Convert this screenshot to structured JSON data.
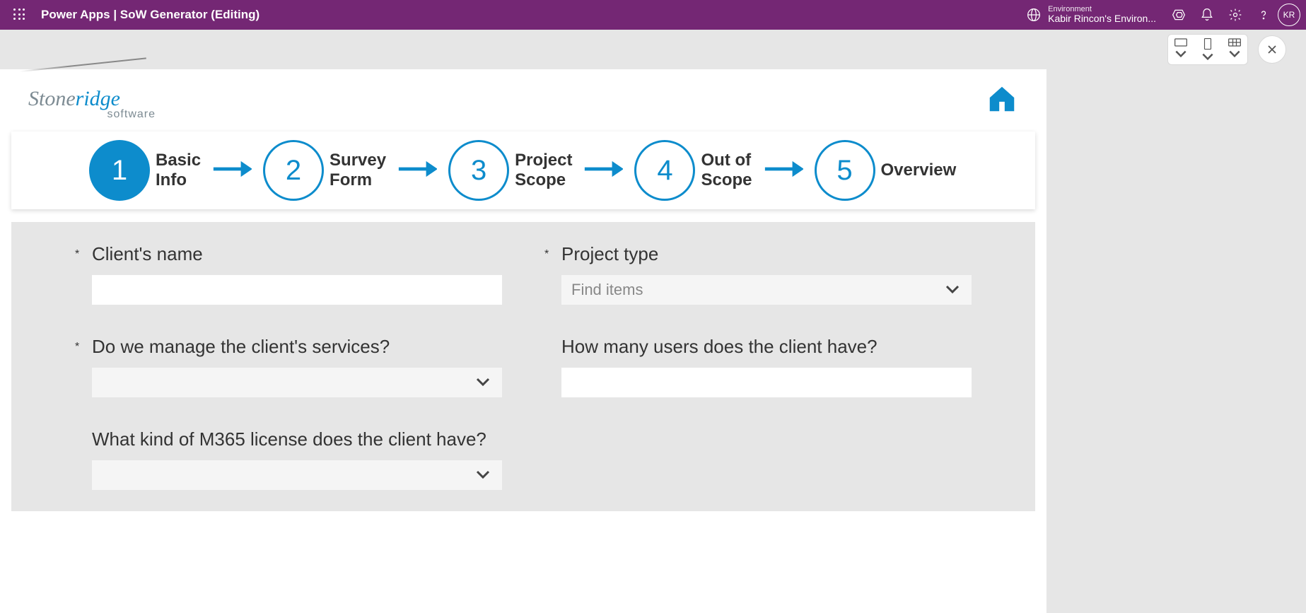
{
  "header": {
    "title": "Power Apps  |  SoW Generator (Editing)",
    "env_label": "Environment",
    "env_name": "Kabir Rincon's Environ...",
    "avatar_initials": "KR"
  },
  "logo": {
    "part1": "Stone",
    "part2": "ridge",
    "sub": "software"
  },
  "steps": [
    {
      "num": "1",
      "label": "Basic\nInfo",
      "active": true
    },
    {
      "num": "2",
      "label": "Survey\nForm",
      "active": false
    },
    {
      "num": "3",
      "label": "Project\nScope",
      "active": false
    },
    {
      "num": "4",
      "label": "Out of\nScope",
      "active": false
    },
    {
      "num": "5",
      "label": "Overview",
      "active": false
    }
  ],
  "form": {
    "client_name": {
      "label": "Client's name",
      "required": true,
      "value": ""
    },
    "project_type": {
      "label": "Project type",
      "required": true,
      "placeholder": "Find items",
      "value": ""
    },
    "manage_services": {
      "label": "Do we manage the client's services?",
      "required": true,
      "value": ""
    },
    "user_count": {
      "label": "How many users does the client have?",
      "required": false,
      "value": ""
    },
    "m365_license": {
      "label": "What kind of M365 license does the client have?",
      "required": false,
      "value": ""
    }
  }
}
